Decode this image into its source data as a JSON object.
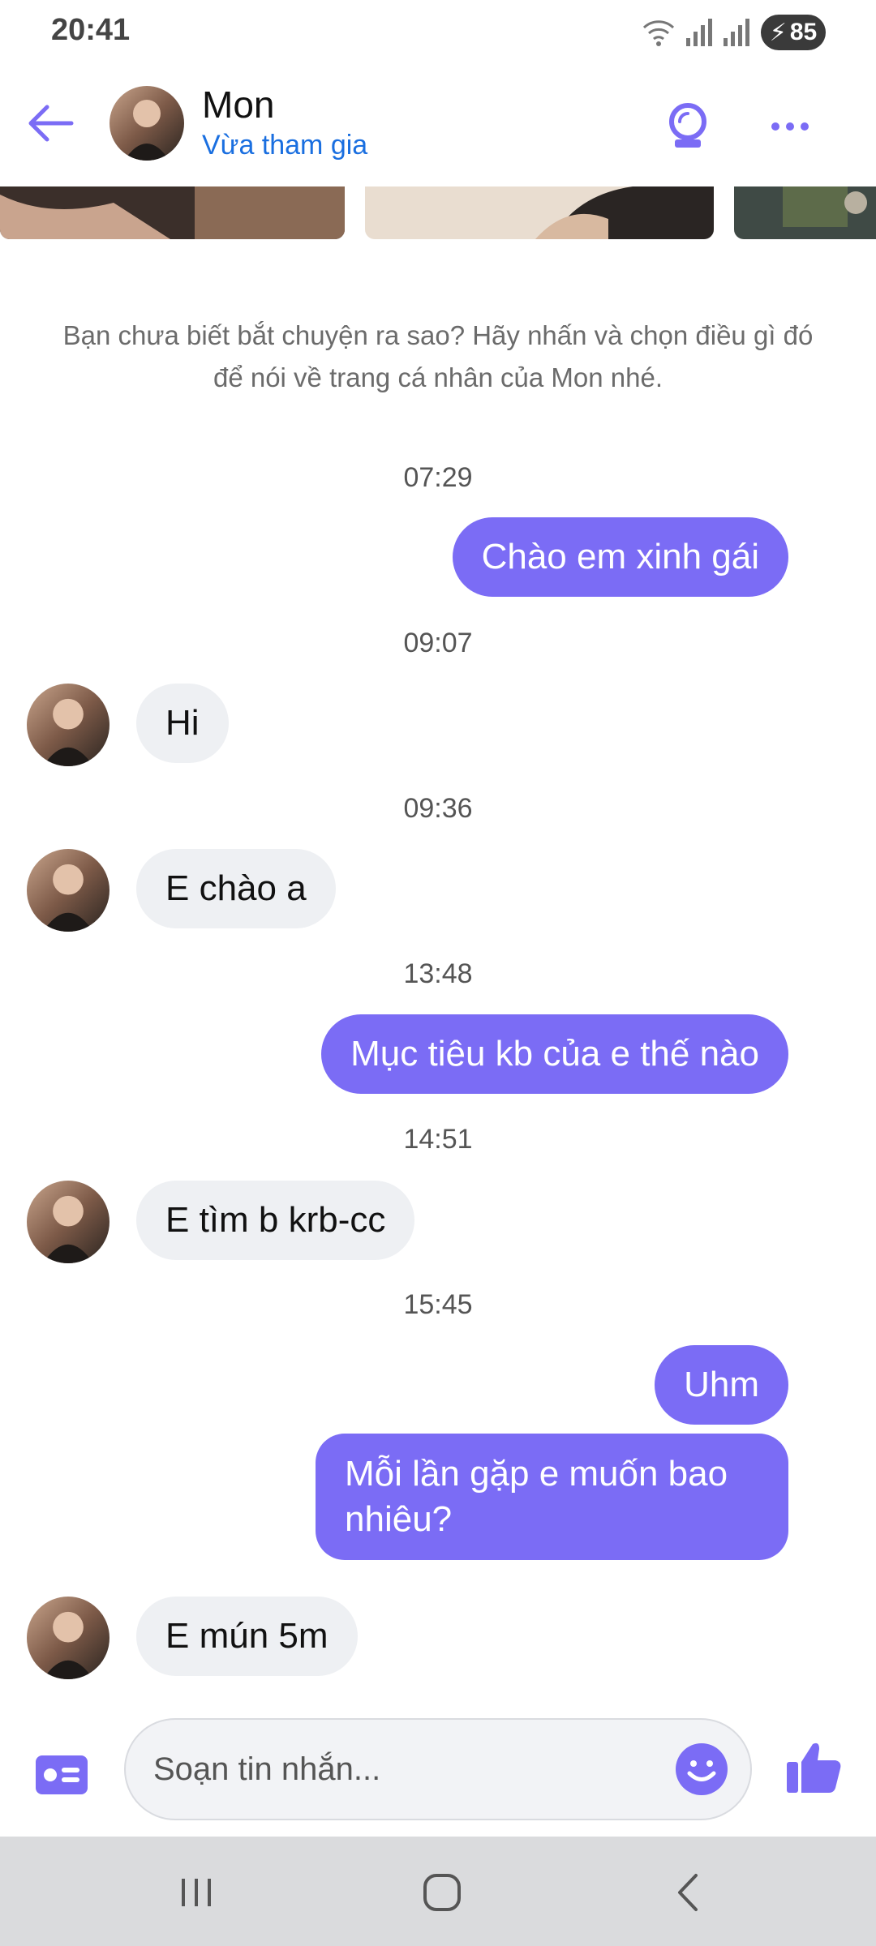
{
  "status_bar": {
    "time": "20:41",
    "battery": "85"
  },
  "header": {
    "name": "Mon",
    "status": "Vừa tham gia"
  },
  "intro": "Bạn chưa biết bắt chuyện ra sao? Hãy nhấn và chọn điều gì đó để nói về trang cá nhân của Mon nhé.",
  "messages": [
    {
      "time": "07:29",
      "text": "Chào em xinh gái"
    },
    {
      "time": "09:07",
      "text": "Hi"
    },
    {
      "time": "09:36",
      "text": "E chào a"
    },
    {
      "time": "13:48",
      "text": "Mục tiêu kb của e thế nào"
    },
    {
      "time": "14:51",
      "text": "E tìm b krb-cc"
    },
    {
      "time": "15:45",
      "text": "Uhm"
    },
    {
      "text": "Mỗi lần gặp e muốn bao nhiêu?"
    },
    {
      "text": "E mún 5m"
    }
  ],
  "composer": {
    "placeholder": "Soạn tin nhắn..."
  },
  "colors": {
    "accent": "#7b6cf5",
    "link": "#1a6fe0",
    "incoming_bubble": "#eef0f3"
  },
  "icons": [
    "back-arrow-icon",
    "crystal-ball-icon",
    "more-dots-icon",
    "contact-card-icon",
    "emoji-icon",
    "thumbs-up-icon",
    "recent-apps-icon",
    "home-icon",
    "nav-back-icon"
  ]
}
